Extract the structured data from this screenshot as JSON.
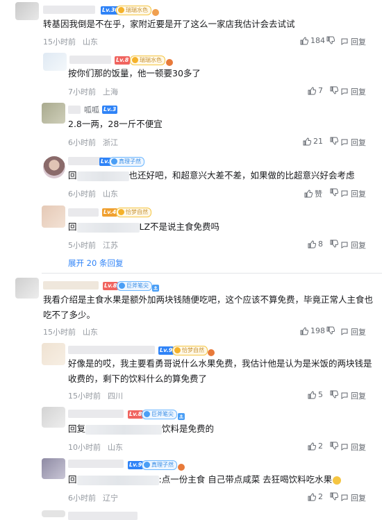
{
  "comments": [
    {
      "level": "Lv.30",
      "medal": "瑞瑞水色",
      "text": "转基因我倒是不在乎，家附近要是开了这么一家店我估计会去试试",
      "time": "15小时前",
      "location": "山东",
      "likes": "184",
      "reply_label": "回复"
    },
    {
      "level": "Lv.8",
      "medal": "瑞瑞水色",
      "text": "按你们那的饭量，他一顿要30多了",
      "time": "7小时前",
      "location": "上海",
      "likes": "7",
      "reply_label": "回复"
    },
    {
      "username": "呱呱",
      "level": "Lv.3",
      "text": "2.8一两，28一斤不便宜",
      "time": "6小时前",
      "location": "浙江",
      "likes": "21",
      "reply_label": "回复"
    },
    {
      "level": "Lv.9",
      "medal": "真理子然",
      "text_prefix": "回",
      "text_mid": "也还好吧，和超意兴大差不差，如果做的比超意兴好会考虑",
      "time": "6小时前",
      "location": "山东",
      "likes": "赞",
      "reply_label": "回复"
    },
    {
      "level": "Lv.4",
      "medal": "恰梦自然",
      "text_prefix": "回",
      "text_mid": "LZ不是说主食免费吗",
      "time": "5小时前",
      "location": "江苏",
      "likes": "8",
      "reply_label": "回复"
    },
    {
      "level": "Lv.8",
      "medal": "巨斧笔尖",
      "text": "我看介绍是主食水果是额外加两块钱随便吃吧，这个应该不算免费，毕竟正常人主食也吃不了多少。",
      "time": "15小时前",
      "location": "山东",
      "likes": "198",
      "reply_label": "回复"
    },
    {
      "level": "Lv.9",
      "medal": "恰梦自然",
      "text": "好像是的哎，我主要看勇哥说什么水果免费，我估计他是认为是米饭的两块钱是收费的，剩下的饮料什么的算免费了",
      "time": "15小时前",
      "location": "四川",
      "likes": "5",
      "reply_label": "回复"
    },
    {
      "level": "Lv.8",
      "medal": "巨斧笔尖",
      "text_prefix": "回复",
      "text_mid": "饮料是免费的",
      "time": "10小时前",
      "location": "山东",
      "likes": "2",
      "reply_label": "回复"
    },
    {
      "level": "Lv.9",
      "medal": "真理子然",
      "text_prefix": "回",
      "text_mid": ":点一份主食 自己带点咸菜 去狂喝饮料吃水果",
      "time": "6小时前",
      "location": "辽宁",
      "likes": "2",
      "reply_label": "回复"
    }
  ],
  "expand_label": "展开 20 条回复",
  "colors": {
    "accent": "#2f83f7",
    "meta": "#9499a0",
    "divider": "#e3e5e7"
  }
}
